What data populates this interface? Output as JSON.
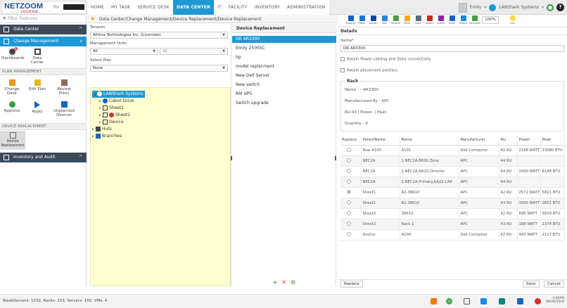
{
  "app": {
    "logo": "NETZOOM",
    "logo_sub": "ENTERPRISE",
    "logo_for": "for"
  },
  "nav": {
    "tabs": [
      "HOME",
      "MY TASK",
      "SERVICE DESK",
      "DATA CENTER",
      "IT",
      "FACILITY",
      "INVENTORY",
      "ADMINISTRATION"
    ],
    "active": "DATA CENTER"
  },
  "user": {
    "name": "Emily",
    "org": "LANShark Systems"
  },
  "sidebar": {
    "filter_placeholder": "Filter Features",
    "modules": {
      "data_center": "Data Center",
      "change_management": "Change Management",
      "inventory_audit": "Inventory and Audit"
    },
    "top_buttons": {
      "dashboards": "Dashboards",
      "data_center": "Data Center"
    },
    "plan_management": {
      "title": "PLAN MANAGEMENT",
      "items": [
        "Change Desk",
        "Edit Plan",
        "Review Plans",
        "Approve",
        "Apply",
        "Unplanned Devices"
      ]
    },
    "device_replacement": {
      "title": "DEVICE REPLACEMENT",
      "item": "Device Replacement"
    },
    "badge": "0"
  },
  "breadcrumb": "Data Center/Change Management/Device Replacement/Device Replacement",
  "toolbar": {
    "items": [
      "Property",
      "Power",
      "Design",
      "VAD",
      "Devices",
      "Mask",
      "Dash",
      "Report",
      "Charts",
      "Rules",
      "Attach",
      "Contracts"
    ],
    "zoom": "100%",
    "info": "Info"
  },
  "tenants": {
    "label": "Tenants",
    "value": "Altima Technologies Inc. (Licensee)",
    "units_label": "Management Units",
    "units_value": "All",
    "units_value2": "All",
    "plan_label": "Select Plan",
    "plan_value": "None"
  },
  "tree": {
    "root": "LANShark Systems",
    "children": [
      "Cabot Drive",
      "Sheet1",
      "Sheet2",
      "Device"
    ],
    "others": [
      "Huts",
      "Branches"
    ]
  },
  "devrep": {
    "title": "Device Replacement",
    "items": [
      "DR AR3300",
      "Emily 2500SC",
      "hp",
      "model replacment",
      "New Dell Server",
      "New switch",
      "RM UPS",
      "Switch upgrade"
    ]
  },
  "details": {
    "title": "Details",
    "name_label": "Name*",
    "name_value": "DR AR3300",
    "retain_power": "Retain Power cabling and Data connectivity",
    "retain_placement": "Retain placement position",
    "rack": {
      "title": "Rack",
      "name": "Name - ~AR3300",
      "manufacturer": "Manufactured By - APC",
      "info": "RU-43 | Power- | Heat-",
      "quantity": "Quantity - 4"
    },
    "columns": [
      "Replace",
      "ParentName",
      "Name",
      "Manufacturer",
      "RU",
      "Power",
      "Heat"
    ],
    "rows": [
      {
        "parent": "Row A100",
        "name": "A101",
        "mfr": "Dell Computer",
        "ru": "42 RU",
        "power": "2188 WATT",
        "heat": "23080 BTU"
      },
      {
        "parent": "NEC2A",
        "name": "1.NEC2A.B830.Zone",
        "mfr": "APC",
        "ru": "44 RU",
        "power": "",
        "heat": ""
      },
      {
        "parent": "NEC2A",
        "name": "1.NEC2A.AA10.Director",
        "mfr": "APC",
        "ru": "44 RU",
        "power": "2400 WATT",
        "heat": "8188 BTU"
      },
      {
        "parent": "NEC2A",
        "name": "1.NEC2A.Primary.AA22.CAP",
        "mfr": "APC",
        "ru": "44 RU",
        "power": "",
        "heat": ""
      },
      {
        "parent": "Sheet1",
        "name": "R2-38K10",
        "mfr": "APC",
        "ru": "42 RU",
        "power": "2572 WATT",
        "heat": "5821 BTU"
      },
      {
        "parent": "Sheet1",
        "name": "R1-38K10",
        "mfr": "APC",
        "ru": "43 RU",
        "power": "1000 WATT",
        "heat": "2601 BTU"
      },
      {
        "parent": "Sheet2",
        "name": "38K10",
        "mfr": "APC",
        "ru": "42 RU",
        "power": "696 WATT",
        "heat": "5839 BTU"
      },
      {
        "parent": "Sheet2",
        "name": "Rack 1",
        "mfr": "APC",
        "ru": "43 RU",
        "power": "188 WATT",
        "heat": "2374 BTU"
      },
      {
        "parent": "Device",
        "name": "A104",
        "mfr": "Dell Computer",
        "ru": "42 RU",
        "power": "480 WATT",
        "heat": "2117 BTU"
      }
    ],
    "replace_label": "Replace",
    "save_label": "Save",
    "cancel_label": "Cancel"
  },
  "status": {
    "text": "BladeServers: 1232, Racks: 153, Servers: 102, VMs: 4",
    "time": "3:00PM",
    "date": "06/28/2018",
    "badge": "22"
  }
}
